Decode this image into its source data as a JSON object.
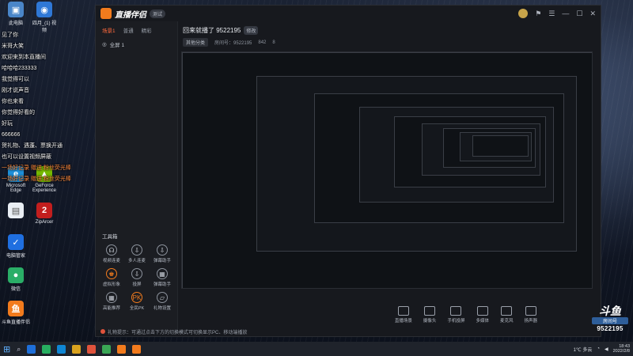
{
  "desktop": {
    "icons": [
      {
        "name": "computer",
        "label": "此电脑",
        "color": "#4a86c9",
        "glyph": "▣"
      },
      {
        "name": "browser",
        "label": "四月_(1) 视频",
        "color": "#2f78d6",
        "glyph": "◉"
      },
      {
        "name": "edge",
        "label": "Microsoft Edge",
        "color": "#1d8fd8",
        "glyph": "e"
      },
      {
        "name": "geforce",
        "label": "GeForce Experience",
        "color": "#76b900",
        "glyph": "▲"
      },
      {
        "name": "doc",
        "label": "",
        "color": "#e9eef4",
        "glyph": "▤"
      },
      {
        "name": "zip-app",
        "label": "ZipArcer",
        "color": "#c21e1e",
        "glyph": "2"
      },
      {
        "name": "security",
        "label": "电脑管家",
        "color": "#1f6fe0",
        "glyph": "✓"
      },
      {
        "name": "wechat",
        "label": "微信",
        "color": "#2aae67",
        "glyph": "●"
      },
      {
        "name": "douyu-helper",
        "label": "斗鱼直播伴侣",
        "color": "#f27b1d",
        "glyph": "鱼"
      }
    ]
  },
  "chat": [
    {
      "tag": "",
      "text": "见了你",
      "color": "#f2f2f2"
    },
    {
      "tag": "",
      "text": "米哥大笑",
      "color": "#f2f2f2"
    },
    {
      "tag": "",
      "text": "欢迎来到本直播间",
      "color": "#f2f2f2"
    },
    {
      "tag": "",
      "text": "哈哈哈233333",
      "color": "#f2f2f2"
    },
    {
      "tag": "",
      "text": "我觉得可以",
      "color": "#f2f2f2"
    },
    {
      "tag": "",
      "text": "刚才说声音",
      "color": "#f2f2f2"
    },
    {
      "tag": "",
      "text": "你也来看",
      "color": "#f2f2f2"
    },
    {
      "tag": "",
      "text": "你觉得好看的",
      "color": "#f2f2f2"
    },
    {
      "tag": "",
      "text": "好玩",
      "color": "#f2f2f2"
    },
    {
      "tag": "",
      "text": "666666",
      "color": "#f2f2f2"
    },
    {
      "tag": "",
      "text": "贺礼物、遇蓬、票换开通",
      "color": "#f2f2f2"
    },
    {
      "tag": "",
      "text": "也可以设置视频屏蔽",
      "color": "#f2f2f2"
    },
    {
      "tag": "",
      "text": "一场好记录 赠送 粉丝荧光棒",
      "color": "#ff8a3d"
    },
    {
      "tag": "",
      "text": "一场好记录 赠送 粉丝荧光棒",
      "color": "#ff8a3d"
    }
  ],
  "app": {
    "name": "直播伴侣",
    "version_badge": "测试",
    "scene_tabs": [
      "场景1",
      "普通",
      "精彩"
    ],
    "scene_item": "全屏 1",
    "tools_title": "工具箱",
    "tools": [
      {
        "label": "视频连麦",
        "icon": "☊",
        "hot": false
      },
      {
        "label": "多人连麦",
        "icon": "⇩",
        "hot": false
      },
      {
        "label": "弹幕助手",
        "icon": "⇩",
        "hot": false
      },
      {
        "label": "虚拟形象",
        "icon": "♚",
        "hot": true
      },
      {
        "label": "投屏",
        "icon": "⇩",
        "hot": false
      },
      {
        "label": "弹幕助手",
        "icon": "▦",
        "hot": false
      },
      {
        "label": "高能推荐",
        "icon": "▦",
        "hot": false
      },
      {
        "label": "全民PK",
        "icon": "PK",
        "hot": true
      },
      {
        "label": "礼物设置",
        "icon": "▱",
        "hot": false
      }
    ],
    "stream_title": "回来就播了 9522195",
    "stream_edit": "修改",
    "stream_meta": {
      "category": "其他分类",
      "room_label": "房间号：9522195",
      "viewers": "842",
      "fans": "8"
    },
    "bottom_tools": [
      "直播场景",
      "摄像头",
      "手机投屏",
      "多媒体",
      "麦克风",
      "扬声器"
    ],
    "notice": "礼物提示：可通过点击下方的切换模式可切换显示PC、移动端播放"
  },
  "watermark": {
    "brand": "斗鱼",
    "room_label": "房间号",
    "room_id": "9522195"
  },
  "taskbar": {
    "weather": "1℃ 多云",
    "time": "18:43",
    "date": "2022/2/8",
    "apps": [
      "#1e6fd9",
      "#27ae60",
      "#0f86d4",
      "#d9a21e",
      "#e0533c",
      "#3aa655",
      "#f27b1d",
      "#f27b1d"
    ]
  }
}
